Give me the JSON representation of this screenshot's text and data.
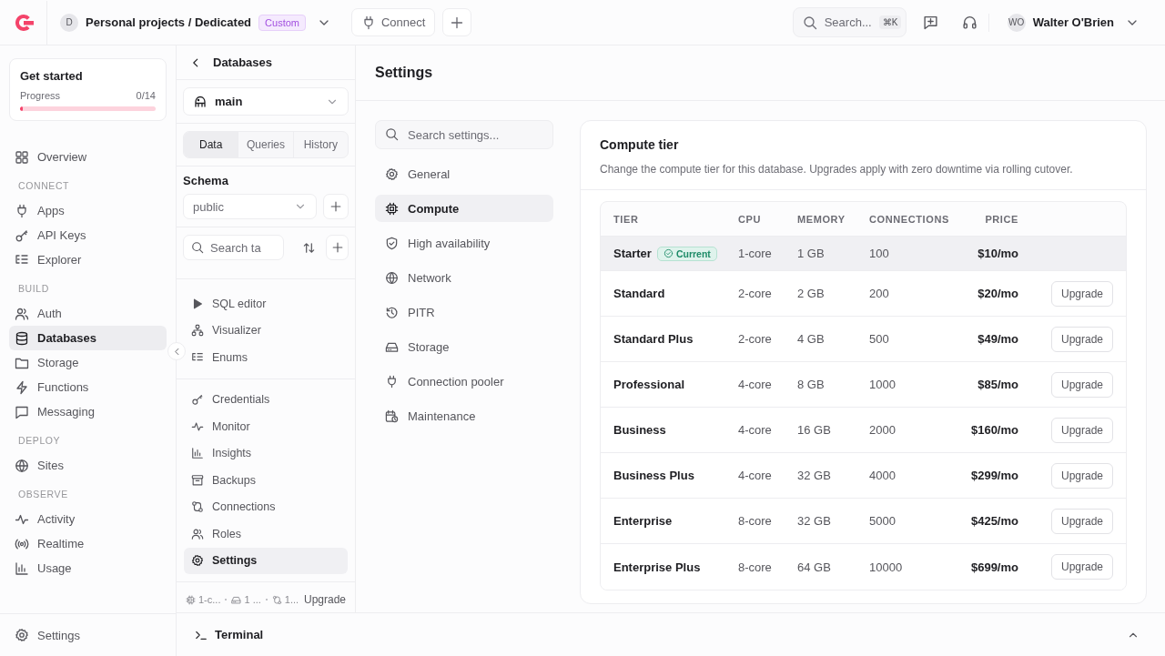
{
  "topbar": {
    "org_avatar": "D",
    "project": "Personal projects / Dedicated",
    "plan_badge": "Custom",
    "connect_button": "Connect",
    "search": {
      "placeholder": "Search...",
      "shortcut": "⌘K"
    },
    "user": {
      "initials": "WO",
      "name": "Walter O'Brien"
    }
  },
  "sidebar": {
    "get_started": {
      "title": "Get started",
      "progress_label": "Progress",
      "progress_value": "0/14",
      "level": 0
    },
    "sections": [
      {
        "items": [
          {
            "label": "Overview",
            "selected": false
          }
        ]
      },
      {
        "heading": "CONNECT",
        "items": [
          {
            "label": "Apps",
            "selected": false
          },
          {
            "label": "API Keys",
            "selected": false
          },
          {
            "label": "Explorer",
            "selected": false
          }
        ]
      },
      {
        "heading": "BUILD",
        "items": [
          {
            "label": "Auth",
            "selected": false
          },
          {
            "label": "Databases",
            "selected": true
          },
          {
            "label": "Storage",
            "selected": false
          },
          {
            "label": "Functions",
            "selected": false
          },
          {
            "label": "Messaging",
            "selected": false
          }
        ]
      },
      {
        "heading": "DEPLOY",
        "items": [
          {
            "label": "Sites",
            "selected": false
          }
        ]
      },
      {
        "heading": "OBSERVE",
        "items": [
          {
            "label": "Activity",
            "selected": false
          },
          {
            "label": "Realtime",
            "selected": false
          },
          {
            "label": "Usage",
            "selected": false
          }
        ]
      }
    ],
    "footer": "Settings"
  },
  "db_panel": {
    "title": "Databases",
    "database": "main",
    "tabs": [
      {
        "label": "Data",
        "selected": true
      },
      {
        "label": "Queries",
        "selected": false
      },
      {
        "label": "History",
        "selected": false
      }
    ],
    "schema_label": "Schema",
    "schema": "public",
    "table_search": {
      "placeholder": "Search ta"
    },
    "tools": [
      {
        "label": "SQL editor",
        "selected": false
      },
      {
        "label": "Visualizer",
        "selected": false
      },
      {
        "label": "Enums",
        "selected": false
      }
    ],
    "nav": [
      {
        "label": "Credentials",
        "selected": false
      },
      {
        "label": "Monitor",
        "selected": false
      },
      {
        "label": "Insights",
        "selected": false
      },
      {
        "label": "Backups",
        "selected": false
      },
      {
        "label": "Connections",
        "selected": false
      },
      {
        "label": "Roles",
        "selected": false
      },
      {
        "label": "Settings",
        "selected": true
      }
    ],
    "footer": {
      "cpu": "1-c...",
      "memory": "1 ...",
      "connections": "1...",
      "link": "Upgrade"
    }
  },
  "main": {
    "title": "Settings",
    "search": {
      "placeholder": "Search settings..."
    },
    "nav": [
      {
        "label": "General",
        "selected": false
      },
      {
        "label": "Compute",
        "selected": true
      },
      {
        "label": "High availability",
        "selected": false
      },
      {
        "label": "Network",
        "selected": false
      },
      {
        "label": "PITR",
        "selected": false
      },
      {
        "label": "Storage",
        "selected": false
      },
      {
        "label": "Connection pooler",
        "selected": false
      },
      {
        "label": "Maintenance",
        "selected": false
      }
    ],
    "card": {
      "title": "Compute tier",
      "description": "Change the compute tier for this database. Upgrades apply with zero downtime via rolling cutover.",
      "columns": [
        "TIER",
        "CPU",
        "MEMORY",
        "CONNECTIONS",
        "PRICE"
      ],
      "rows": [
        {
          "tier": "Starter",
          "badge": "Current",
          "cpu": "1-core",
          "memory": "1 GB",
          "connections": "100",
          "price": "$10/mo",
          "selected": true
        },
        {
          "tier": "Standard",
          "cpu": "2-core",
          "memory": "2 GB",
          "connections": "200",
          "price": "$20/mo",
          "action": "Upgrade",
          "selected": false
        },
        {
          "tier": "Standard Plus",
          "cpu": "2-core",
          "memory": "4 GB",
          "connections": "500",
          "price": "$49/mo",
          "action": "Upgrade",
          "selected": false
        },
        {
          "tier": "Professional",
          "cpu": "4-core",
          "memory": "8 GB",
          "connections": "1000",
          "price": "$85/mo",
          "action": "Upgrade",
          "selected": false
        },
        {
          "tier": "Business",
          "cpu": "4-core",
          "memory": "16 GB",
          "connections": "2000",
          "price": "$160/mo",
          "action": "Upgrade",
          "selected": false
        },
        {
          "tier": "Business Plus",
          "cpu": "4-core",
          "memory": "32 GB",
          "connections": "4000",
          "price": "$299/mo",
          "action": "Upgrade",
          "selected": false
        },
        {
          "tier": "Enterprise",
          "cpu": "8-core",
          "memory": "32 GB",
          "connections": "5000",
          "price": "$425/mo",
          "action": "Upgrade",
          "selected": false
        },
        {
          "tier": "Enterprise Plus",
          "cpu": "8-core",
          "memory": "64 GB",
          "connections": "10000",
          "price": "$699/mo",
          "action": "Upgrade",
          "selected": false
        }
      ]
    }
  },
  "terminal": {
    "label": "Terminal"
  }
}
